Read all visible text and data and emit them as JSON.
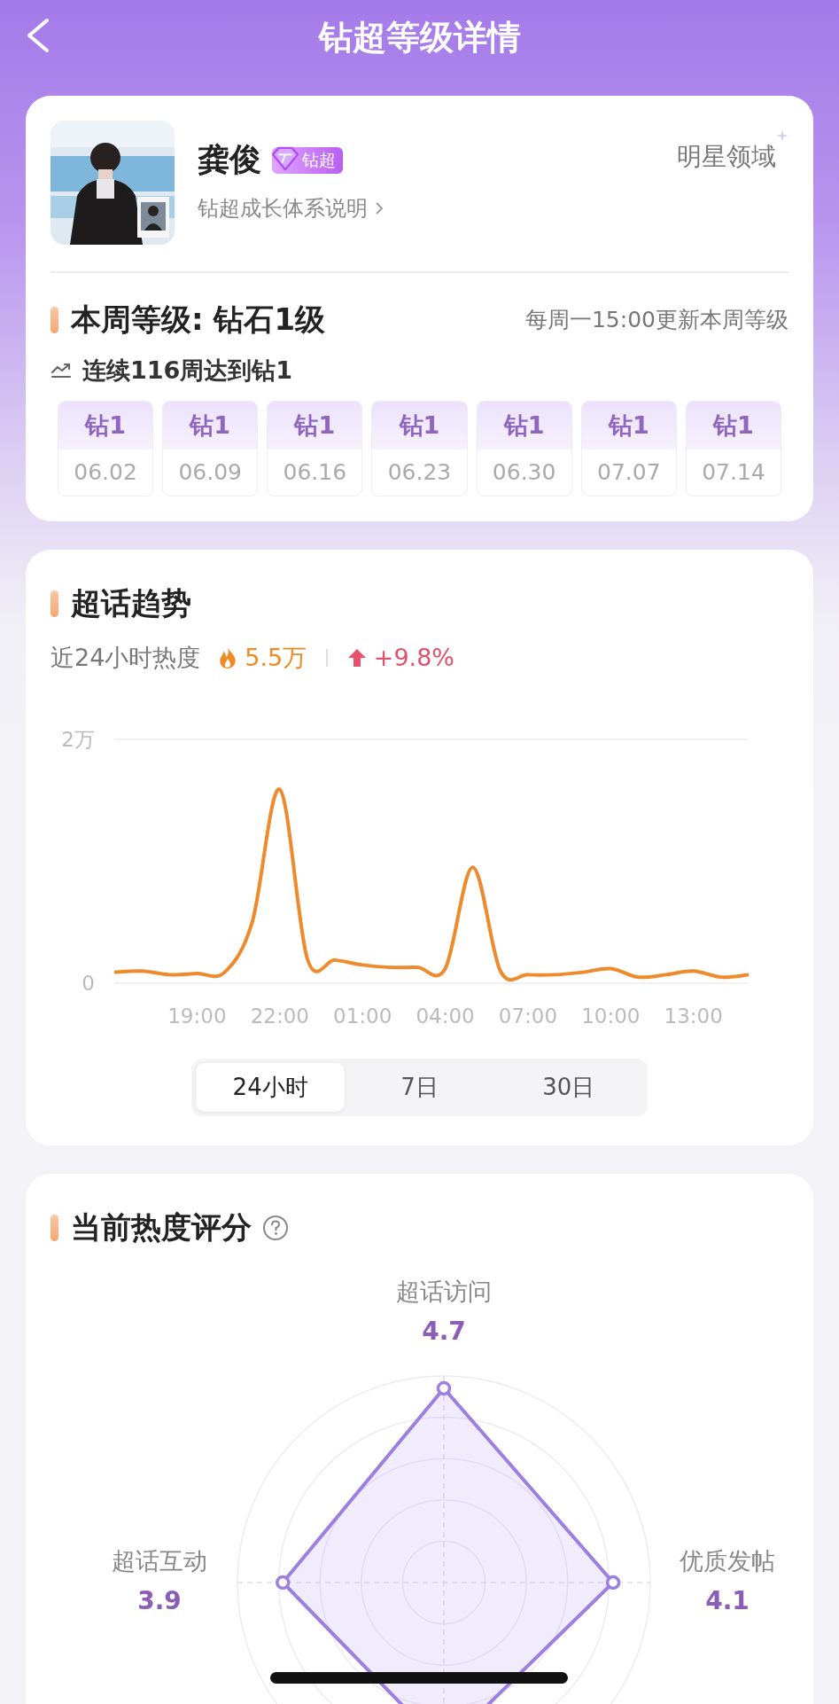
{
  "header": {
    "title": "钻超等级详情"
  },
  "profile": {
    "name": "龚俊",
    "badge": "钻超",
    "link": "钻超成长体系说明",
    "field": "明星领域"
  },
  "weekly": {
    "title": "本周等级: 钻石1级",
    "update_note": "每周一15:00更新本周等级",
    "streak": "连续116周达到钻1",
    "weeks": [
      {
        "level": "钻1",
        "date": "06.02"
      },
      {
        "level": "钻1",
        "date": "06.09"
      },
      {
        "level": "钻1",
        "date": "06.16"
      },
      {
        "level": "钻1",
        "date": "06.23"
      },
      {
        "level": "钻1",
        "date": "06.30"
      },
      {
        "level": "钻1",
        "date": "07.07"
      },
      {
        "level": "钻1",
        "date": "07.14"
      }
    ]
  },
  "trend": {
    "title": "超话趋势",
    "heat_label": "近24小时热度",
    "heat_value": "5.5万",
    "change": "+9.8%",
    "chart_data": {
      "type": "line",
      "categories": [
        null,
        null,
        null,
        "19:00",
        null,
        null,
        "22:00",
        null,
        null,
        "01:00",
        null,
        null,
        "04:00",
        null,
        null,
        "07:00",
        null,
        null,
        "10:00",
        null,
        null,
        "13:00",
        null,
        null
      ],
      "series": [
        {
          "color": "#ee8a2c",
          "values": [
            0.09,
            0.1,
            0.07,
            0.08,
            0.09,
            0.5,
            1.59,
            0.2,
            0.19,
            0.15,
            0.13,
            0.13,
            0.12,
            0.95,
            0.1,
            0.07,
            0.07,
            0.09,
            0.12,
            0.05,
            0.07,
            0.1,
            0.05,
            0.07
          ]
        }
      ],
      "ylim": [
        0,
        2
      ],
      "yticks": [
        {
          "value": 0,
          "label": "0"
        },
        {
          "value": 2,
          "label": "2万"
        }
      ]
    },
    "ranges": [
      {
        "label": "24小时",
        "selected": true
      },
      {
        "label": "7日",
        "selected": false
      },
      {
        "label": "30日",
        "selected": false
      }
    ]
  },
  "score": {
    "title": "当前热度评分",
    "axes": [
      {
        "kind": "top",
        "label": "超话访问",
        "value": "4.7"
      },
      {
        "kind": "left",
        "label": "超话互动",
        "value": "3.9"
      },
      {
        "kind": "right",
        "label": "优质发帖",
        "value": "4.1"
      }
    ]
  }
}
